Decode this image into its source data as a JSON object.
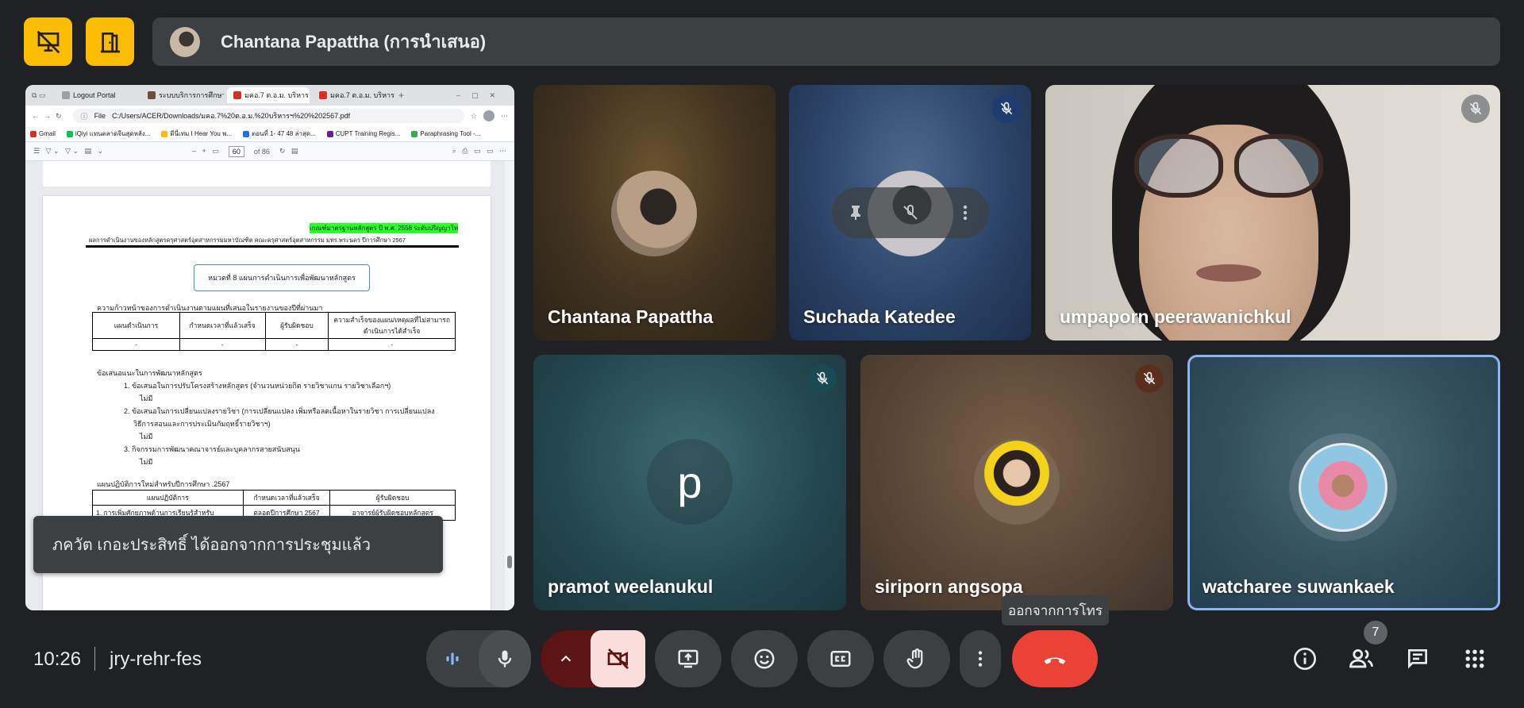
{
  "presenter": {
    "name": "Chantana Papattha (การนำเสนอ)"
  },
  "browser": {
    "tabs": [
      {
        "label": "Logout Portal",
        "color": "#9aa0a6"
      },
      {
        "label": "ระบบบริการการศึกษา",
        "color": "#6d4c41"
      },
      {
        "label": "มคอ.7 ต.อ.ม. บริหาร",
        "color": "#d93025"
      },
      {
        "label": "มคอ.7 ต.อ.ม. บริหาร",
        "color": "#d93025"
      }
    ],
    "address_prefix": "File",
    "address": "C:/Users/ACER/Downloads/มคอ.7%20ต.อ.ม.%20บริหารฯ%20%202567.pdf",
    "bookmarks": [
      {
        "label": "Gmail",
        "color": "#d93025"
      },
      {
        "label": "iQiyi แทนตลาดจีนสุดหลัง...",
        "color": "#00c853"
      },
      {
        "label": "ดีนี่เท่ม I Hear You พ...",
        "color": "#fbbc04"
      },
      {
        "label": "ตอนที่ 1- 47 48 ล่าสุด...",
        "color": "#1a73e8"
      },
      {
        "label": "CUPT Training Regis...",
        "color": "#6a1b9a"
      },
      {
        "label": "Paraphrasing Tool -...",
        "color": "#34a853"
      }
    ],
    "pdf_page_number": "60",
    "pdf_page_total": "of 86"
  },
  "pdf": {
    "highlight": "เกณฑ์มาตรฐานหลักสูตร ปี พ.ศ. 2558 ระดับปริญญาโท",
    "header": "ผลการดำเนินงานของหลักสูตรครุศาสตร์อุตสาหกรรมมหาบัณฑิต คณะครุศาสตร์อุตสาหกรรม มทร.พระนคร ปีการศึกษา 2567",
    "section_title": "หมวดที่ 8 แผนการดำเนินการเพื่อพัฒนาหลักสูตร",
    "progress_title": "ความก้าวหน้าของการดำเนินงานตามแผนที่เสนอในรายงานของปีที่ผ่านมา",
    "table1_headers": [
      "แผนดำเนินการ",
      "กำหนดเวลาที่แล้วเสร็จ",
      "ผู้รับผิดชอบ",
      "ความสำเร็จของแผน/เหตุผลที่ไม่สามารถดำเนินการได้สำเร็จ"
    ],
    "table1_row": [
      "-",
      "-",
      "-",
      "-"
    ],
    "suggest_title": "ข้อเสนอแนะในการพัฒนาหลักสูตร",
    "items": [
      "1.   ข้อเสนอในการปรับโครงสร้างหลักสูตร (จำนวนหน่วยกิต รายวิชาแกน รายวิชาเลือกฯ)",
      "ไม่มี",
      "2.  ข้อเสนอในการเปลี่ยนแปลงรายวิชา (การเปลี่ยนแปลง เพิ่มหรือลดเนื้อหาในรายวิชา การเปลี่ยนแปลง",
      "วิธีการสอนและการประเมินกัมฤทธิ์รายวิชาฯ)",
      "ไม่มี",
      "3.  กิจกรรมการพัฒนาคณาจารย์และบุคลากรสายสนับสนุน",
      "ไม่มี"
    ],
    "new_plan_title": "แผนปฏิบัติการใหม่สำหรับปีการศึกษา .2567",
    "table2_headers": [
      "แผนปฏิบัติการ",
      "กำหนดเวลาที่แล้วเสร็จ",
      "ผู้รับผิดชอบ"
    ],
    "table2_row": [
      "1. การเพิ่มศักยภาพด้านการเรียนรู้สำหรับ",
      "ตลอดปีการศึกษา 2567",
      "อาจารย์ผู้รับผิดชอบหลักสูตร"
    ]
  },
  "toast": "ภควัต เกอะประสิทธิ์ ได้ออกจากการประชุมแล้ว",
  "participants": [
    {
      "name": "Chantana Papattha"
    },
    {
      "name": "Suchada Katedee"
    },
    {
      "name": "umpaporn peerawanichkul"
    },
    {
      "name": "pramot weelanukul",
      "initial": "p"
    },
    {
      "name": "siriporn angsopa"
    },
    {
      "name": "watcharee suwankaek"
    }
  ],
  "footer": {
    "time": "10:26",
    "meeting_code": "jry-rehr-fes",
    "leave_tooltip": "ออกจากการโทร",
    "participant_count": "7"
  },
  "colors": {
    "accent_yellow": "#fbbc04",
    "leave_red": "#ea4335",
    "active_border": "#8ab4f8"
  }
}
